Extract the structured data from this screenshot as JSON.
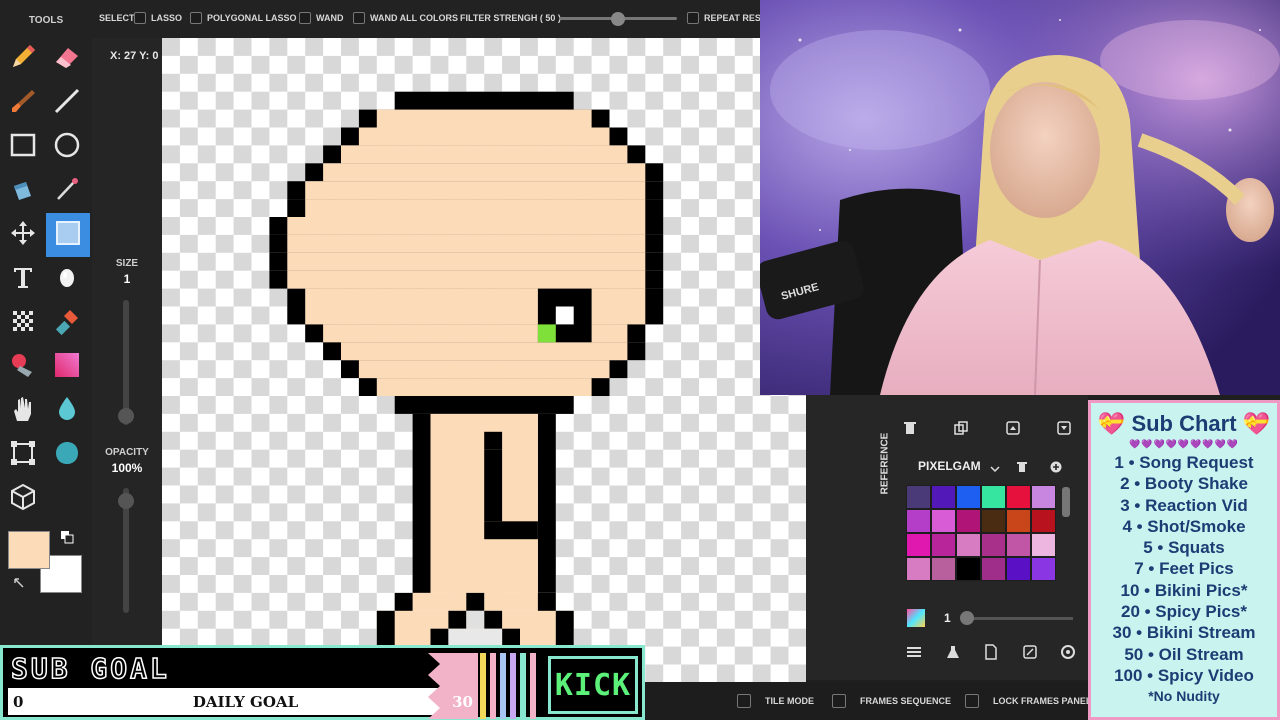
{
  "tools_panel": {
    "title": "TOOLS",
    "tools": [
      "pencil",
      "eraser",
      "brush",
      "line",
      "rectangle",
      "ellipse",
      "bucket",
      "eyedropper",
      "move",
      "select-rect",
      "text",
      "egg",
      "dither",
      "stamp",
      "color-replace",
      "gradient",
      "hand",
      "blur",
      "crop",
      "blob",
      "cube"
    ],
    "primary_color": "#fcdcb8",
    "secondary_color": "#ffffff"
  },
  "options_column": {
    "coords": "X: 27 Y: 0",
    "size_label": "SIZE",
    "size_value": "1",
    "size_level": 0.0,
    "opacity_label": "OPACITY",
    "opacity_value": "100%",
    "opacity_level": 1.0
  },
  "select_bar": {
    "select_label": "SELECT:",
    "lasso": "LASSO",
    "polygonal_lasso": "POLYGONAL LASSO",
    "wand": "WAND",
    "wand_all_colors": "WAND ALL COLORS",
    "filter_strength": "FILTER STRENGH ( 50 )",
    "filter_level": 0.5,
    "repeat": "REPEAT RESIZ"
  },
  "palette_panel": {
    "reference_label": "REFERENCE",
    "palette_name": "PIXELGAM",
    "swatches": [
      [
        "#4a3a78",
        "#5218b8",
        "#1e5ef0",
        "#36e6a0",
        "#e6123d",
        "#c986e0"
      ],
      [
        "#b43ec8",
        "#d85cd6",
        "#b01477",
        "#4a2c12",
        "#c9461a",
        "#b8121f"
      ],
      [
        "#e018b0",
        "#b8249a",
        "#d77bc3",
        "#a8308a",
        "#c256a6",
        "#ecb6e0"
      ],
      [
        "#d77bc3",
        "#b85f9e",
        "#000000",
        "#9e2e8a",
        "#5a10c4",
        "#8a37e3"
      ]
    ],
    "layer_count": "1"
  },
  "bottom_bar": {
    "tile_mode": "TILE MODE",
    "frames_sequence": "FRAMES SEQUENCE",
    "lock_frames_panel": "LOCK FRAMES PANEL"
  },
  "sub_chart": {
    "title": "Sub Chart",
    "items": [
      "1 • Song Request",
      "2 • Booty Shake",
      "3 • Reaction Vid",
      "4 • Shot/Smoke",
      "5 • Squats",
      "7 • Feet Pics",
      "10 • Bikini Pics*",
      "20 • Spicy Pics*",
      "30 • Bikini Stream",
      "50 • Oil Stream",
      "100 • Spicy Video"
    ],
    "note": "*No Nudity"
  },
  "sub_goal": {
    "title": "SUB GOAL",
    "current": "0",
    "label": "DAILY GOAL",
    "target": "30",
    "progress": 0.0,
    "platform": "KICK"
  },
  "webcam": {
    "mic_brand": "SHURE"
  }
}
